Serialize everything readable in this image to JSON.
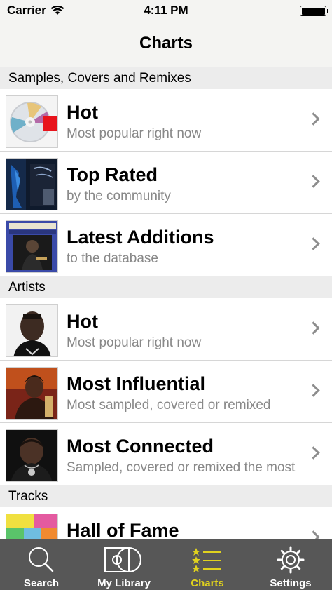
{
  "status_bar": {
    "carrier": "Carrier",
    "time": "4:11 PM"
  },
  "nav": {
    "title": "Charts"
  },
  "sections": [
    {
      "header": "Samples, Covers and Remixes",
      "rows": [
        {
          "title": "Hot",
          "subtitle": "Most popular right now",
          "thumb": "cd-album-cover"
        },
        {
          "title": "Top Rated",
          "subtitle": "by the community",
          "thumb": "dark-blue-album-cover"
        },
        {
          "title": "Latest Additions",
          "subtitle": "to the database",
          "thumb": "jazz-album-cover"
        }
      ]
    },
    {
      "header": "Artists",
      "rows": [
        {
          "title": "Hot",
          "subtitle": "Most popular right now",
          "thumb": "artist-photo"
        },
        {
          "title": "Most Influential",
          "subtitle": "Most sampled, covered or remixed",
          "thumb": "artist-photo"
        },
        {
          "title": "Most Connected",
          "subtitle": "Sampled, covered or remixed the most",
          "thumb": "artist-photo"
        }
      ]
    },
    {
      "header": "Tracks",
      "rows": [
        {
          "title": "Hall of Fame",
          "subtitle": "",
          "thumb": "colorful-album-cover"
        }
      ]
    }
  ],
  "tabs": [
    {
      "label": "Search",
      "icon": "search-icon",
      "active": false
    },
    {
      "label": "My Library",
      "icon": "library-icon",
      "active": false
    },
    {
      "label": "Charts",
      "icon": "charts-icon",
      "active": true
    },
    {
      "label": "Settings",
      "icon": "gear-icon",
      "active": false
    }
  ],
  "colors": {
    "active_tab": "#e0d21e",
    "tab_bar": "#575757",
    "section_header": "#ececec"
  }
}
